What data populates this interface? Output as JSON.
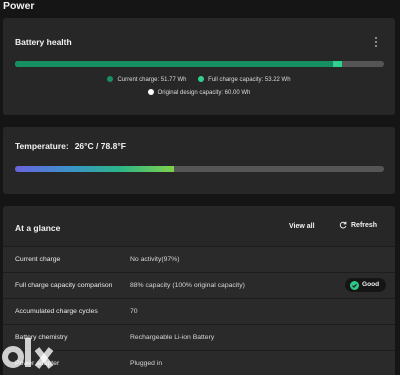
{
  "page": {
    "title": "Power"
  },
  "battery_health": {
    "title": "Battery health",
    "more_icon": "more-vertical-icon",
    "bar": {
      "current_charge_wh": 51.77,
      "full_charge_capacity_wh": 53.22,
      "design_capacity_wh": 60.0
    },
    "legend": {
      "current_charge": "Current charge:  51.77 Wh",
      "full_charge_capacity": "Full charge capacity:  53.22 Wh",
      "original_design_capacity": "Original design capacity:  60.00 Wh"
    }
  },
  "temperature": {
    "label": "Temperature:",
    "value": "26°C / 78.8°F",
    "bar_fraction": 0.43
  },
  "at_a_glance": {
    "title": "At a glance",
    "view_all": "View all",
    "refresh": "Refresh",
    "refresh_icon": "refresh-icon",
    "rows": [
      {
        "label": "Current charge",
        "value": "No activity(97%)"
      },
      {
        "label": "Full charge capacity comparison",
        "value": "88% capacity (100% original capacity)",
        "badge": "Good",
        "badge_icon": "check-circle-icon"
      },
      {
        "label": "Accumulated charge cycles",
        "value": "70"
      },
      {
        "label": "Battery chemistry",
        "value": "Rechargeable Li-ion Battery"
      },
      {
        "label": "Power adapter",
        "value": "Plugged in"
      }
    ]
  },
  "watermark": {
    "text": "olx",
    "icon": "olx-logo-icon"
  },
  "colors": {
    "background": "#151515",
    "card": "#272727",
    "current_charge": "#169060",
    "full_charge": "#2fcf8f",
    "design_capacity": "#ffffff",
    "badge_good": "#2ec986"
  }
}
